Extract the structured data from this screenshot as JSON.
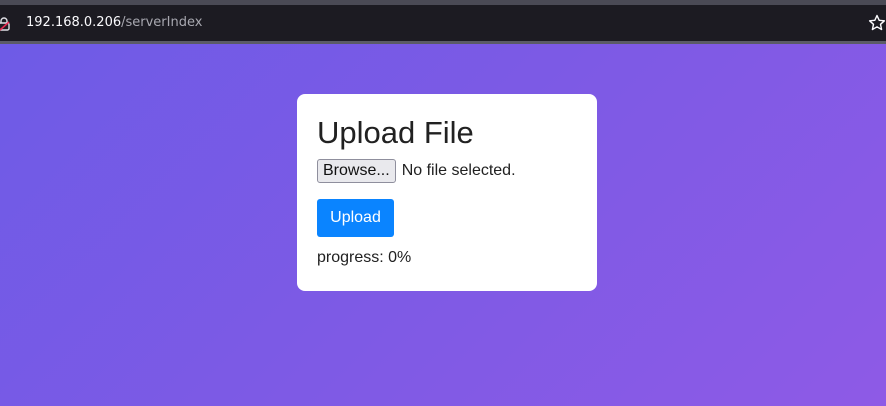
{
  "browser": {
    "url_host": "192.168.0.206",
    "url_path": "/serverIndex"
  },
  "card": {
    "title": "Upload File",
    "browse_label": "Browse...",
    "file_status": "No file selected.",
    "upload_label": "Upload",
    "progress_label": "progress:",
    "progress_value": "0%"
  },
  "colors": {
    "upload_button": "#0a84ff",
    "gradient_start": "#6e5be6",
    "gradient_end": "#8e5ae6"
  },
  "icons": [
    "lock-icon",
    "bookmark-star-icon"
  ]
}
